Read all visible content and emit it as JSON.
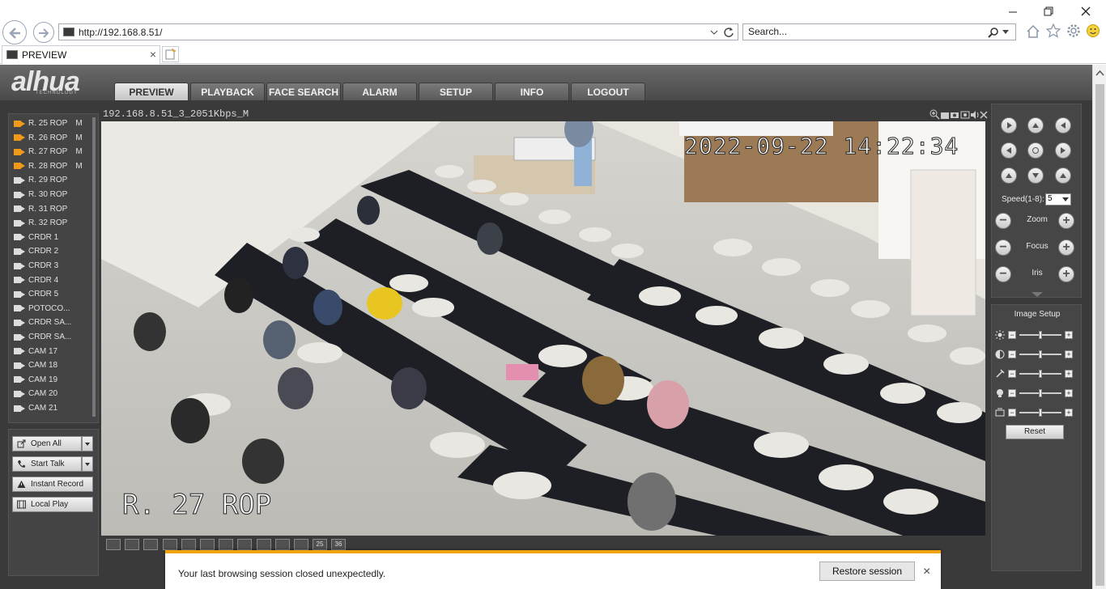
{
  "browser": {
    "url": "http://192.168.8.51/",
    "search_placeholder": "Search...",
    "tab_title": "PREVIEW",
    "tab_close": "×"
  },
  "header": {
    "logo": "alhua",
    "logo_sub": "TECHNOLOGY",
    "tabs": [
      "PREVIEW",
      "PLAYBACK",
      "FACE SEARCH",
      "ALARM",
      "SETUP",
      "INFO",
      "LOGOUT"
    ],
    "active_tab": "PREVIEW"
  },
  "channels": [
    {
      "label": "R. 25 ROP",
      "mark": "M",
      "active": true
    },
    {
      "label": "R. 26 ROP",
      "mark": "M",
      "active": true
    },
    {
      "label": "R. 27 ROP",
      "mark": "M",
      "active": true
    },
    {
      "label": "R. 28 ROP",
      "mark": "M",
      "active": true
    },
    {
      "label": "R. 29 ROP",
      "mark": "",
      "active": false
    },
    {
      "label": "R. 30 ROP",
      "mark": "",
      "active": false
    },
    {
      "label": "R. 31 ROP",
      "mark": "",
      "active": false
    },
    {
      "label": "R. 32 ROP",
      "mark": "",
      "active": false
    },
    {
      "label": "CRDR 1",
      "mark": "",
      "active": false
    },
    {
      "label": "CRDR 2",
      "mark": "",
      "active": false
    },
    {
      "label": "CRDR 3",
      "mark": "",
      "active": false
    },
    {
      "label": "CRDR 4",
      "mark": "",
      "active": false
    },
    {
      "label": "CRDR 5",
      "mark": "",
      "active": false
    },
    {
      "label": "POTOCO...",
      "mark": "",
      "active": false
    },
    {
      "label": "CRDR SA...",
      "mark": "",
      "active": false
    },
    {
      "label": "CRDR SA...",
      "mark": "",
      "active": false
    },
    {
      "label": "CAM 17",
      "mark": "",
      "active": false
    },
    {
      "label": "CAM 18",
      "mark": "",
      "active": false
    },
    {
      "label": "CAM 19",
      "mark": "",
      "active": false
    },
    {
      "label": "CAM 20",
      "mark": "",
      "active": false
    },
    {
      "label": "CAM 21",
      "mark": "",
      "active": false
    }
  ],
  "actions": {
    "open_all": "Open All",
    "start_talk": "Start Talk",
    "instant_record": "Instant Record",
    "local_play": "Local Play"
  },
  "video": {
    "stream_title": "192.168.8.51_3_2051Kbps_M",
    "osd_timestamp": "2022-09-22 14:22:34",
    "osd_channel": "R. 27 ROP",
    "layout_labels": [
      "25",
      "36"
    ]
  },
  "ptz": {
    "speed_label": "Speed(1-8):",
    "speed_value": "5",
    "zoom_label": "Zoom",
    "focus_label": "Focus",
    "iris_label": "Iris"
  },
  "image_setup": {
    "title": "Image Setup",
    "reset_label": "Reset"
  },
  "notification": {
    "message": "Your last browsing session closed unexpectedly.",
    "restore_label": "Restore session",
    "close": "×"
  },
  "colors": {
    "accent_orange": "#f19a1a",
    "notif_bar": "#f0a30a"
  }
}
